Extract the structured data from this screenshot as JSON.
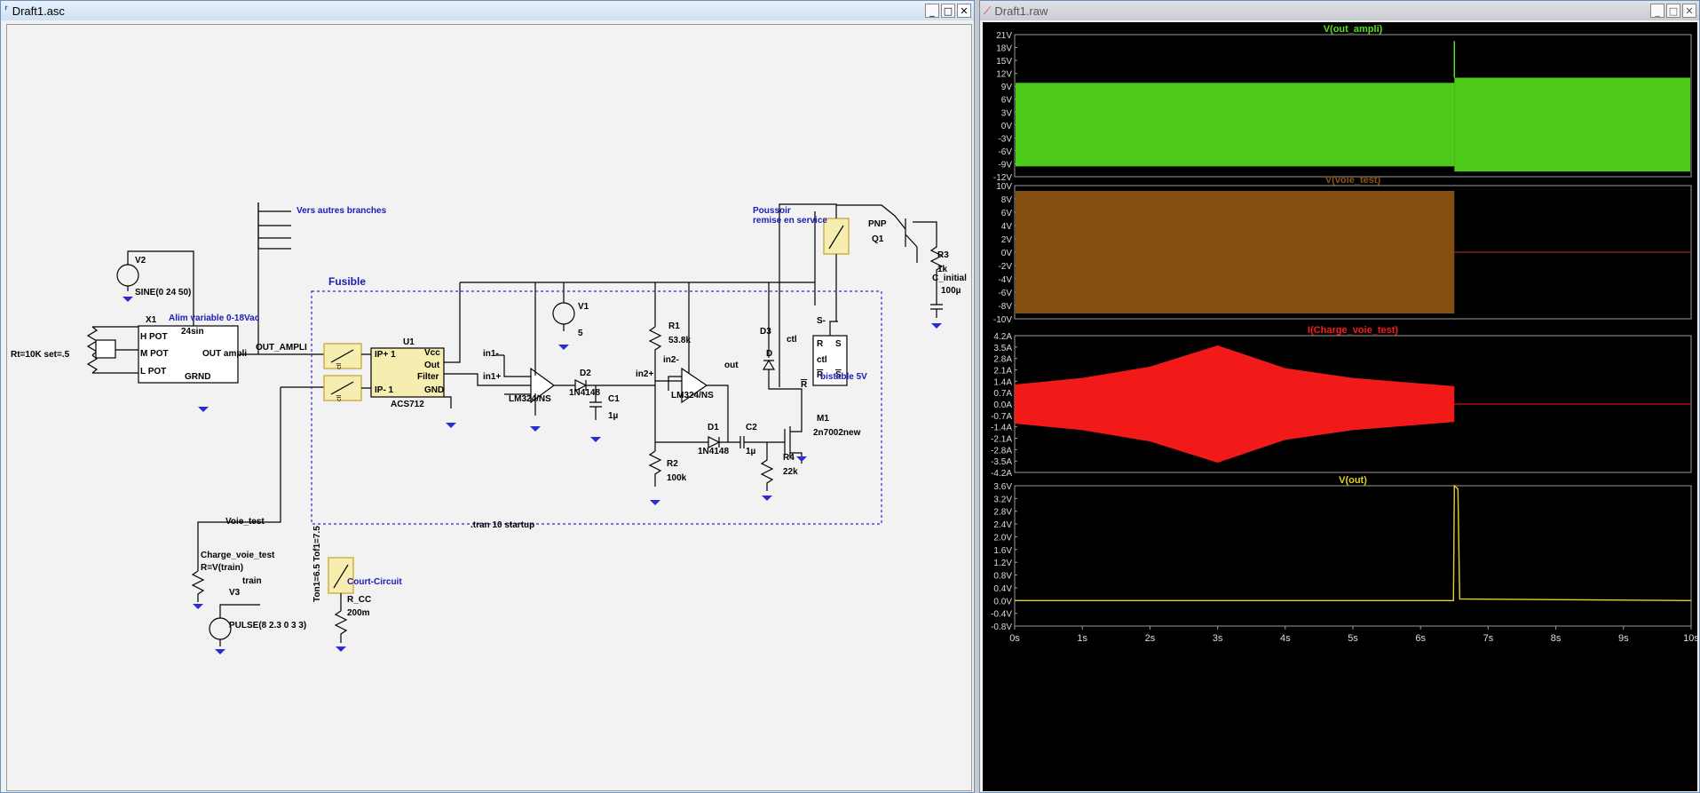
{
  "schematic_window": {
    "title": "Draft1.asc",
    "controls": {
      "minimize": "_",
      "maximize": "□",
      "close": "✕"
    }
  },
  "waveform_window": {
    "title": "Draft1.raw",
    "controls": {
      "minimize": "_",
      "maximize": "□",
      "close": "✕"
    }
  },
  "schematic": {
    "labels": {
      "v2": "V2",
      "v2_value": "SINE(0 24 50)",
      "x1": "X1",
      "alim": "Alim variable 0-18Vac",
      "sin24": "24sin",
      "pot_h": "H  POT",
      "pot_m": "M  POT",
      "out_ampli_pin": "OUT  ampli",
      "pot_l": "L  POT",
      "grnd": "GRND",
      "rt": "Rt=10K set=.5",
      "out_ampli_net": "OUT_AMPLI",
      "vers": "Vers autres branches",
      "fusible": "Fusible",
      "u1": "U1",
      "ip_plus": "IP+  1",
      "ip_minus": "IP-  1",
      "vcc": "Vcc",
      "out": "Out",
      "filter": "Filter",
      "gnd": "GND",
      "acs": "ACS712",
      "ctl1": "ctl",
      "ctl2": "ctl",
      "in1_minus": "in1-",
      "in1_plus": "in1+",
      "lm1": "LM324/NS",
      "d2": "D2",
      "d2_value": "1N4148",
      "v1": "V1",
      "v1_value": "5",
      "c1": "C1",
      "c1_value": "1µ",
      "r1": "R1",
      "r1_value": "53.8k",
      "in2_minus": "in2-",
      "in2_plus": "in2+",
      "lm2": "LM324/NS",
      "out_net": "out",
      "d1": "D1",
      "d1_value": "1N4148",
      "c2": "C2",
      "c2_value": "1µ",
      "r2": "R2",
      "r2_value": "100k",
      "r4": "R4",
      "r4_value": "22k",
      "m1": "M1",
      "m1_value": "2n7002new",
      "d3": "D3",
      "d3_ctl": "ctl",
      "d3_d": "D",
      "bistable": "bistable 5V",
      "r_pin": "R",
      "s_pin": "S",
      "ctl_pin": "ctl",
      "rbar_pin": "R",
      "sbar_pin": "S",
      "s_minus": "S-",
      "rbar_out": "R",
      "poussoir1": "Poussoir",
      "poussoir2": "remise en service",
      "pnp": "PNP",
      "q1": "Q1",
      "r3": "R3",
      "r3_value": "1k",
      "c_initial": "C_initial",
      "c_initial_value": "100µ",
      "tran": ".tran 10 startup",
      "voie_test": "Voie_test",
      "charge": "Charge_voie_test",
      "charge_value": "R=V(train)",
      "train": "train",
      "v3": "V3",
      "v3_value": "PULSE(8 2.3 0 3 3)",
      "ton": "Ton1=6.5 Tof1=7.5",
      "court": "Court-Circuit",
      "rcc": "R_CC",
      "rcc_value": "200m"
    }
  },
  "waveform": {
    "panes": [
      {
        "title": "V(out_ampli)",
        "color": "#55e01c",
        "ticks": [
          "21V",
          "18V",
          "15V",
          "12V",
          "9V",
          "6V",
          "3V",
          "0V",
          "-3V",
          "-6V",
          "-9V",
          "-12V"
        ],
        "ymin": -12,
        "ymax": 21
      },
      {
        "title": "V(voie_test)",
        "color": "#8a5412",
        "ticks": [
          "10V",
          "8V",
          "6V",
          "4V",
          "2V",
          "0V",
          "-2V",
          "-4V",
          "-6V",
          "-8V",
          "-10V"
        ],
        "ymin": -10,
        "ymax": 10
      },
      {
        "title": "I(Charge_voie_test)",
        "color": "#ff1a1a",
        "ticks": [
          "4.2A",
          "3.5A",
          "2.8A",
          "2.1A",
          "1.4A",
          "0.7A",
          "0.0A",
          "-0.7A",
          "-1.4A",
          "-2.1A",
          "-2.8A",
          "-3.5A",
          "-4.2A"
        ],
        "ymin": -4.2,
        "ymax": 4.2
      },
      {
        "title": "V(out)",
        "color": "#e6d21a",
        "ticks": [
          "3.6V",
          "3.2V",
          "2.8V",
          "2.4V",
          "2.0V",
          "1.6V",
          "1.2V",
          "0.8V",
          "0.4V",
          "0.0V",
          "-0.4V",
          "-0.8V"
        ],
        "ymin": -0.8,
        "ymax": 3.6
      }
    ],
    "x_ticks": [
      "0s",
      "1s",
      "2s",
      "3s",
      "4s",
      "5s",
      "6s",
      "7s",
      "8s",
      "9s",
      "10s"
    ],
    "x_range": [
      0,
      10
    ],
    "cutoff_time": 6.5
  }
}
